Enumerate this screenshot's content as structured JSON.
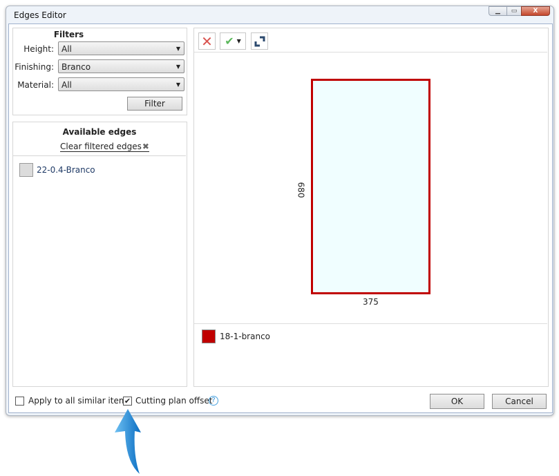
{
  "window": {
    "title": "Edges Editor",
    "close_glyph": "X",
    "min_glyph": "▁",
    "max_glyph": "▭"
  },
  "filters": {
    "heading": "Filters",
    "height_label": "Height:",
    "height_value": "All",
    "finishing_label": "Finishing:",
    "finishing_value": "Branco",
    "material_label": "Material:",
    "material_value": "All",
    "filter_button": "Filter"
  },
  "available": {
    "heading": "Available edges",
    "clear_link": "Clear filtered edges",
    "items": [
      {
        "label": "22-0.4-Branco",
        "color": "#dcdcdc"
      }
    ]
  },
  "drawing": {
    "height_label": "680",
    "width_label": "375",
    "edge_color": "#c00000",
    "fill_color": "#f0feff"
  },
  "legend": [
    {
      "label": "18-1-branco",
      "color": "#c00000"
    }
  ],
  "footer": {
    "apply_all_label": "Apply to all similar items",
    "apply_all_checked": false,
    "cutting_label": "Cutting plan offset",
    "cutting_checked": true,
    "help_glyph": "?",
    "ok": "OK",
    "cancel": "Cancel"
  }
}
